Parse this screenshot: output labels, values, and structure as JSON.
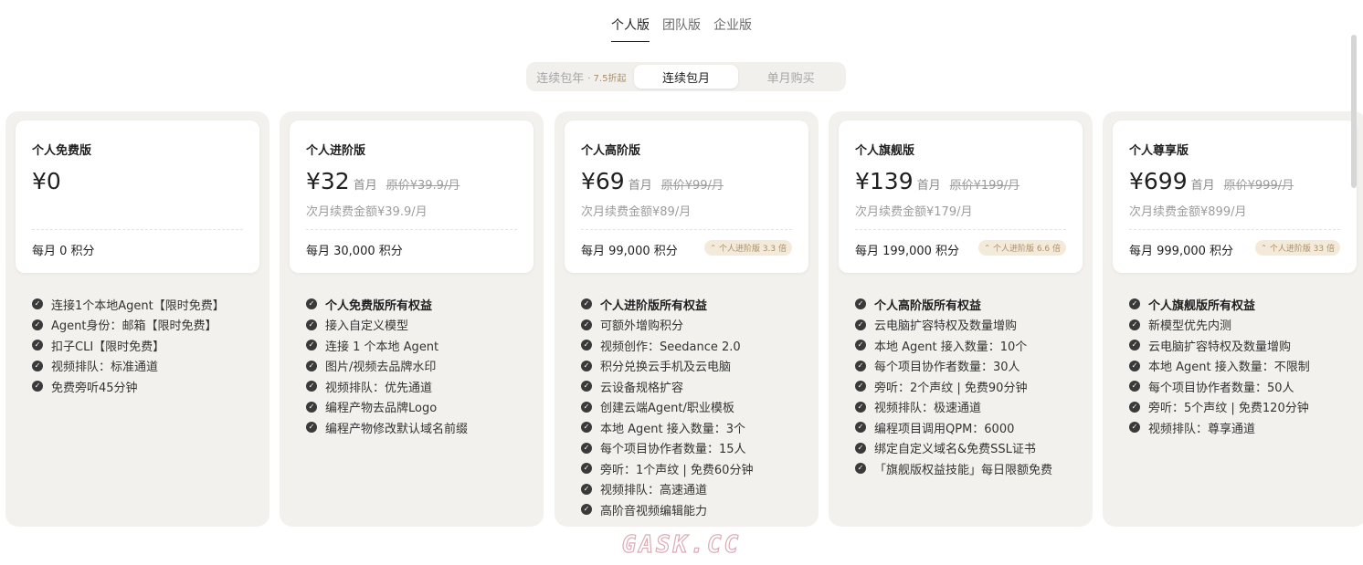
{
  "tabs": [
    {
      "label": "个人版",
      "active": true
    },
    {
      "label": "团队版",
      "active": false
    },
    {
      "label": "企业版",
      "active": false
    }
  ],
  "billing": {
    "options": [
      {
        "label": "连续包年",
        "sub": "· 7.5折起",
        "active": false
      },
      {
        "label": "连续包月",
        "sub": "",
        "active": true
      },
      {
        "label": "单月购买",
        "sub": "",
        "active": false
      }
    ]
  },
  "plans": [
    {
      "name": "个人免费版",
      "price": "¥0",
      "first": "",
      "original": "",
      "renew": "",
      "credits": "每月 0 积分",
      "multiplier": "",
      "features": [
        {
          "text": "连接1个本地Agent【限时免费】",
          "bold": false
        },
        {
          "text": "Agent身份：邮箱【限时免费】",
          "bold": false
        },
        {
          "text": "扣子CLI【限时免费】",
          "bold": false
        },
        {
          "text": "视频排队：标准通道",
          "bold": false
        },
        {
          "text": "免费旁听45分钟",
          "bold": false
        }
      ]
    },
    {
      "name": "个人进阶版",
      "price": "¥32",
      "first": "首月",
      "original": "原价¥39.9/月",
      "renew": "次月续费金额¥39.9/月",
      "credits": "每月 30,000 积分",
      "multiplier": "",
      "features": [
        {
          "text": "个人免费版所有权益",
          "bold": true
        },
        {
          "text": "接入自定义模型",
          "bold": false
        },
        {
          "text": "连接 1 个本地 Agent",
          "bold": false
        },
        {
          "text": "图片/视频去品牌水印",
          "bold": false
        },
        {
          "text": "视频排队：优先通道",
          "bold": false
        },
        {
          "text": "编程产物去品牌Logo",
          "bold": false
        },
        {
          "text": "编程产物修改默认域名前缀",
          "bold": false
        }
      ]
    },
    {
      "name": "个人高阶版",
      "price": "¥69",
      "first": "首月",
      "original": "原价¥99/月",
      "renew": "次月续费金额¥89/月",
      "credits": "每月 99,000 积分",
      "multiplier": "个人进阶版 3.3 倍",
      "features": [
        {
          "text": "个人进阶版所有权益",
          "bold": true
        },
        {
          "text": "可额外增购积分",
          "bold": false
        },
        {
          "text": "视频创作：Seedance 2.0",
          "bold": false
        },
        {
          "text": "积分兑换云手机及云电脑",
          "bold": false
        },
        {
          "text": "云设备规格扩容",
          "bold": false
        },
        {
          "text": "创建云端Agent/职业模板",
          "bold": false
        },
        {
          "text": "本地 Agent 接入数量：3个",
          "bold": false
        },
        {
          "text": "每个项目协作者数量：15人",
          "bold": false
        },
        {
          "text": "旁听：1个声纹 | 免费60分钟",
          "bold": false
        },
        {
          "text": "视频排队：高速通道",
          "bold": false
        },
        {
          "text": "高阶音视频编辑能力",
          "bold": false
        }
      ]
    },
    {
      "name": "个人旗舰版",
      "price": "¥139",
      "first": "首月",
      "original": "原价¥199/月",
      "renew": "次月续费金额¥179/月",
      "credits": "每月 199,000 积分",
      "multiplier": "个人进阶版 6.6 倍",
      "features": [
        {
          "text": "个人高阶版所有权益",
          "bold": true
        },
        {
          "text": "云电脑扩容特权及数量增购",
          "bold": false
        },
        {
          "text": "本地 Agent 接入数量：10个",
          "bold": false
        },
        {
          "text": "每个项目协作者数量：30人",
          "bold": false
        },
        {
          "text": "旁听：2个声纹 | 免费90分钟",
          "bold": false
        },
        {
          "text": "视频排队：极速通道",
          "bold": false
        },
        {
          "text": "编程项目调用QPM：6000",
          "bold": false
        },
        {
          "text": "绑定自定义域名&免费SSL证书",
          "bold": false
        },
        {
          "text": "「旗舰版权益技能」每日限额免费",
          "bold": false
        }
      ]
    },
    {
      "name": "个人尊享版",
      "price": "¥699",
      "first": "首月",
      "original": "原价¥999/月",
      "renew": "次月续费金额¥899/月",
      "credits": "每月 999,000 积分",
      "multiplier": "个人进阶版 33 倍",
      "features": [
        {
          "text": "个人旗舰版所有权益",
          "bold": true
        },
        {
          "text": "新模型优先内测",
          "bold": false
        },
        {
          "text": "云电脑扩容特权及数量增购",
          "bold": false
        },
        {
          "text": "本地 Agent 接入数量：不限制",
          "bold": false
        },
        {
          "text": "每个项目协作者数量：50人",
          "bold": false
        },
        {
          "text": "旁听：5个声纹 | 免费120分钟",
          "bold": false
        },
        {
          "text": "视频排队：尊享通道",
          "bold": false
        }
      ]
    }
  ],
  "watermark": "GASK.CC",
  "colors": {
    "panel_bg": "#f2f1ed",
    "badge_bg": "#f3ead9",
    "badge_text": "#a8906a",
    "check": "#3a3a3a"
  },
  "icons": {
    "check": "check-circle-icon",
    "multiplier": "double-chevron-up-icon"
  }
}
